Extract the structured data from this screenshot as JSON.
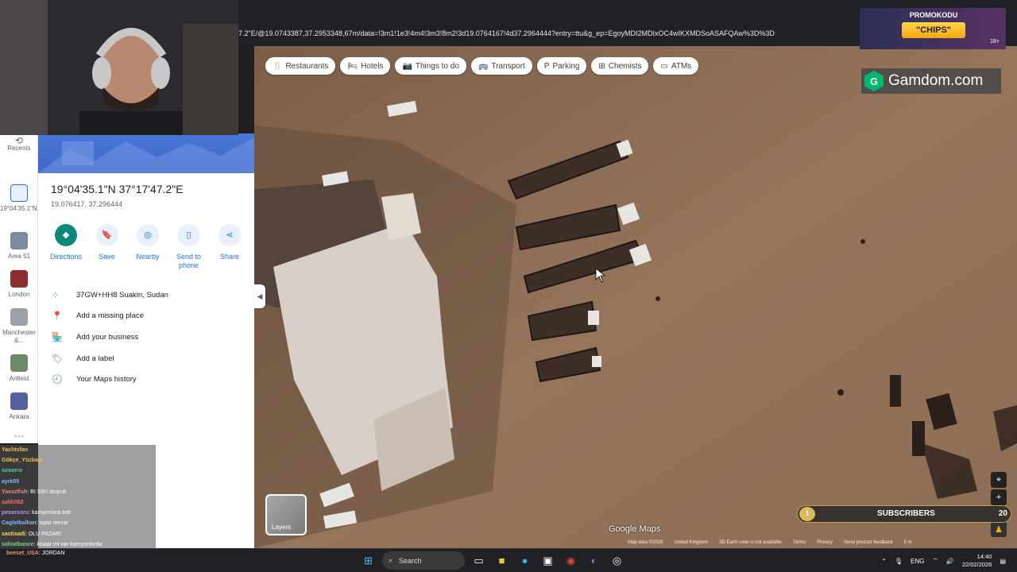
{
  "browser": {
    "url": "7.2\"E/@19.0743387,37.2953348,67m/data=!3m1!1e3!4m4!3m3!8m2!3d19.0764167!4d37.2964444?entry=ttu&g_ep=EgoyMDI2MDIxOC4wIKXMDSoASAFQAw%3D%3D"
  },
  "chips": [
    {
      "icon": "🍴",
      "label": "Restaurants"
    },
    {
      "icon": "🛏",
      "label": "Hotels"
    },
    {
      "icon": "📷",
      "label": "Things to do"
    },
    {
      "icon": "🚌",
      "label": "Transport"
    },
    {
      "icon": "P",
      "label": "Parking"
    },
    {
      "icon": "⊞",
      "label": "Chemists"
    },
    {
      "icon": "▭",
      "label": "ATMs"
    }
  ],
  "rail": {
    "recents": "Recents",
    "items": [
      {
        "label": "19°04'35.1\"N..."
      },
      {
        "label": "Area 51"
      },
      {
        "label": "London"
      },
      {
        "label": "Manchester &..."
      },
      {
        "label": "Anfield"
      },
      {
        "label": "Ankara"
      }
    ],
    "more": "⋯"
  },
  "place": {
    "title": "19°04'35.1\"N 37°17'47.2\"E",
    "decimal": "19.076417, 37.296444",
    "actions": [
      {
        "label": "Directions",
        "icon": "◆"
      },
      {
        "label": "Save",
        "icon": "🔖"
      },
      {
        "label": "Nearby",
        "icon": "◎"
      },
      {
        "label": "Send to phone",
        "icon": "▯"
      },
      {
        "label": "Share",
        "icon": "⋖"
      }
    ],
    "rows": [
      {
        "icon": "⁘",
        "label": "37GW+HH8 Suakin, Sudan"
      },
      {
        "icon": "📍",
        "label": "Add a missing place"
      },
      {
        "icon": "🏪",
        "label": "Add your business"
      },
      {
        "icon": "🏷",
        "label": "Add a label"
      },
      {
        "icon": "🕘",
        "label": "Your Maps history"
      }
    ]
  },
  "overlay": {
    "gamdom": "Gamdom.com",
    "gamdom_logo": "G",
    "promo_title": "PROMOKODU",
    "promo_code": "\"CHIPS\"",
    "promo_age": "18+",
    "subscribers_label": "SUBSCRIBERS",
    "subscribers_left": "1",
    "subscribers_right": "20"
  },
  "chat": [
    {
      "user": "Yachtsfan",
      "msg": ""
    },
    {
      "user": "Gökçe_Yüzbaşı",
      "msg": ""
    },
    {
      "user": "sosorro",
      "msg": ""
    },
    {
      "user": "ayrk05",
      "msg": ""
    },
    {
      "user": "Yavuzfish",
      "msg": ": BI SIKI doqrult"
    },
    {
      "user": "salih362",
      "msg": ""
    },
    {
      "user": "pesorsoru",
      "msg": ": kamyonlara bak"
    },
    {
      "user": "Caglatbalkan",
      "msg": ": topla mezar"
    },
    {
      "user": "sastisadi",
      "msg": ": OLU PAZARI"
    },
    {
      "user": "sahiatbance",
      "msg": ": kisaar mi var-kamyonlarda"
    }
  ],
  "chat_bottom": {
    "user": "beeset_USA",
    "msg": ": JORDAN"
  },
  "map": {
    "layers_label": "Layers",
    "google": "Google Maps",
    "attribution": [
      "Map data ©2026",
      "Map data ©2026",
      "United Kingdom",
      "3D Earth view is not available",
      "Terms",
      "Privacy",
      "Send product feedback",
      "5 m"
    ]
  },
  "taskbar": {
    "search": "Search",
    "lang": "ENG",
    "time": "14:40",
    "date": "22/02/2026"
  }
}
